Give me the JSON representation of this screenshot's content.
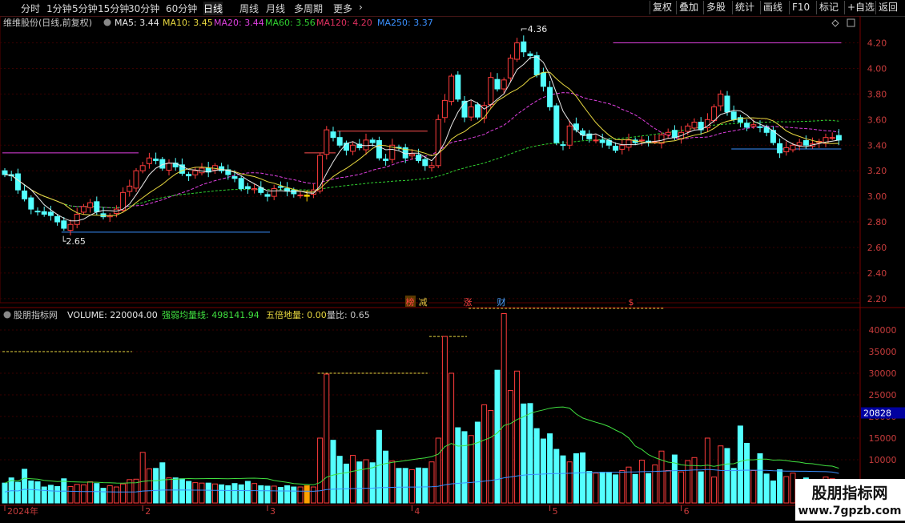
{
  "toolbar": {
    "period_tabs": [
      "分时",
      "1分钟",
      "5分钟",
      "15分钟",
      "30分钟",
      "60分钟",
      "日线",
      "周线",
      "月线",
      "多周期",
      "更多"
    ],
    "active_tab": "日线",
    "right_buttons": [
      "复权",
      "叠加",
      "多股",
      "统计",
      "画线",
      "F10",
      "标记",
      "+自选",
      "返回"
    ]
  },
  "price_panel": {
    "stock_title": "维维股份(日线,前复权)",
    "ma_legend": [
      {
        "label": "MA5: 3.44",
        "color": "#e8e8e8"
      },
      {
        "label": "MA10: 3.45",
        "color": "#e8d840"
      },
      {
        "label": "MA20: 3.44",
        "color": "#e040e0"
      },
      {
        "label": "MA60: 3.56",
        "color": "#30d030"
      },
      {
        "label": "MA120: 4.20",
        "color": "#e03060"
      },
      {
        "label": "MA250: 3.37",
        "color": "#3a90ff"
      }
    ],
    "high_label": "4.36",
    "low_label": "2.65",
    "event_markers": [
      {
        "text": "榜",
        "color": "#ff4040",
        "bg": "#5a3a00"
      },
      {
        "text": "减",
        "color": "#e8c040",
        "bg": "#000"
      },
      {
        "text": "涨",
        "color": "#ff4040",
        "bg": "#000"
      },
      {
        "text": "财",
        "color": "#50a0ff",
        "bg": "#000"
      },
      {
        "text": "$",
        "color": "#ff4040",
        "bg": "#000"
      }
    ]
  },
  "volume_panel": {
    "legend": [
      {
        "label": "股朋指标网",
        "color": "#c8c8c8"
      },
      {
        "label": "VOLUME: 220004.00",
        "color": "#e8e8e8"
      },
      {
        "label": "强弱均量线: 498141.94",
        "color": "#40e040"
      },
      {
        "label": "五倍地量: 0.00",
        "color": "#e8d840"
      },
      {
        "label": "量比: 0.65",
        "color": "#c8c8c8"
      }
    ],
    "current_value_box": "20828"
  },
  "date_axis": [
    {
      "label": "2024年",
      "day": 0
    },
    {
      "label": "2",
      "day": 21
    },
    {
      "label": "3",
      "day": 40
    },
    {
      "label": "4",
      "day": 62
    },
    {
      "label": "5",
      "day": 83
    },
    {
      "label": "6",
      "day": 103
    },
    {
      "label": "7",
      "day": 124
    }
  ],
  "colors": {
    "up": "#ff3c3c",
    "down": "#54ffff",
    "background": "#000000",
    "grid": "#3a0000",
    "axis_text": "#c83c3c"
  },
  "chart_data": {
    "type": "candlestick",
    "price_axis": {
      "ylim": [
        2.08,
        4.36
      ],
      "ticks": [
        2.2,
        2.4,
        2.6,
        2.8,
        3.0,
        3.2,
        3.4,
        3.6,
        3.8,
        4.0,
        4.2
      ]
    },
    "volume_axis": {
      "ylim": [
        0,
        45000
      ],
      "ticks": [
        10000,
        15000,
        20000,
        25000,
        30000,
        35000,
        40000
      ]
    },
    "days": 128,
    "close": [
      3.17,
      3.16,
      3.05,
      2.98,
      2.9,
      2.88,
      2.86,
      2.85,
      2.8,
      2.75,
      2.78,
      2.86,
      2.92,
      2.95,
      2.88,
      2.84,
      2.85,
      2.9,
      3.03,
      3.08,
      3.2,
      3.24,
      3.3,
      3.28,
      3.22,
      3.26,
      3.23,
      3.18,
      3.16,
      3.2,
      3.22,
      3.19,
      3.24,
      3.2,
      3.17,
      3.14,
      3.06,
      3.06,
      3.06,
      3.03,
      3.0,
      3.06,
      3.07,
      3.04,
      3.02,
      3.01,
      3.0,
      3.05,
      3.32,
      3.52,
      3.46,
      3.4,
      3.36,
      3.4,
      3.38,
      3.44,
      3.42,
      3.3,
      3.28,
      3.4,
      3.38,
      3.3,
      3.33,
      3.28,
      3.24,
      3.24,
      3.6,
      3.75,
      3.94,
      3.76,
      3.62,
      3.7,
      3.62,
      3.71,
      3.93,
      3.84,
      3.91,
      4.08,
      4.2,
      4.13,
      4.1,
      3.95,
      3.86,
      3.7,
      3.42,
      3.4,
      3.55,
      3.52,
      3.48,
      3.45,
      3.44,
      3.42,
      3.4,
      3.36,
      3.4,
      3.44,
      3.42,
      3.44,
      3.42,
      3.43,
      3.48,
      3.5,
      3.46,
      3.5,
      3.55,
      3.58,
      3.52,
      3.6,
      3.7,
      3.8,
      3.66,
      3.6,
      3.58,
      3.54,
      3.56,
      3.54,
      3.5,
      3.42,
      3.34,
      3.38,
      3.4,
      3.42,
      3.4,
      3.41,
      3.43,
      3.46,
      3.46,
      3.44
    ],
    "volume": [
      4600,
      5800,
      4800,
      7800,
      5100,
      4900,
      3700,
      4100,
      3800,
      5600,
      3800,
      4300,
      4200,
      4900,
      4500,
      3400,
      4000,
      3700,
      4400,
      5400,
      5500,
      11700,
      7900,
      8000,
      9300,
      5800,
      5800,
      5600,
      5000,
      4700,
      4600,
      4600,
      4400,
      4200,
      4000,
      4500,
      4200,
      5000,
      4500,
      4000,
      3900,
      3900,
      3600,
      4000,
      3700,
      3700,
      4000,
      3700,
      15000,
      29800,
      14500,
      10800,
      9000,
      11000,
      9500,
      10000,
      9300,
      16800,
      12000,
      9700,
      8000,
      8000,
      7700,
      8100,
      8000,
      9500,
      15000,
      38500,
      30000,
      17400,
      16500,
      15600,
      18700,
      22700,
      21400,
      30700,
      43800,
      26000,
      30500,
      22900,
      23000,
      17200,
      14800,
      16000,
      12400,
      10900,
      9500,
      11400,
      11600,
      7300,
      6900,
      7100,
      7100,
      6500,
      7500,
      8300,
      6600,
      9900,
      6800,
      8800,
      12000,
      7500,
      11100,
      7200,
      9800,
      10500,
      7200,
      15000,
      6000,
      13200,
      12600,
      8000,
      17800,
      13800,
      7500,
      11400,
      6700,
      5100,
      7700,
      6100,
      6900,
      5200,
      5800,
      5300,
      4800,
      6000,
      5600,
      5200
    ],
    "horizontal_levels": [
      {
        "kind": "price",
        "value": 4.2,
        "from": 93,
        "to": 127,
        "color": "#e040e0"
      },
      {
        "kind": "price",
        "value": 3.34,
        "from": 0,
        "to": 20,
        "color": "#e040e0"
      },
      {
        "kind": "price",
        "value": 3.34,
        "from": 46,
        "to": 50,
        "color": "#ff5050"
      },
      {
        "kind": "price",
        "value": 3.51,
        "from": 51,
        "to": 64,
        "color": "#ff5050"
      },
      {
        "kind": "price",
        "value": 2.72,
        "from": 9,
        "to": 40,
        "color": "#3a90ff"
      },
      {
        "kind": "price",
        "value": 3.37,
        "from": 111,
        "to": 127,
        "color": "#3a90ff"
      },
      {
        "kind": "volume",
        "value": 35000,
        "from": 0,
        "to": 19,
        "color": "#e8d840"
      },
      {
        "kind": "volume",
        "value": 30000,
        "from": 48,
        "to": 64,
        "color": "#e8d840"
      },
      {
        "kind": "volume",
        "value": 38500,
        "from": 65,
        "to": 70,
        "color": "#e8d840"
      },
      {
        "kind": "volume",
        "value": 45000,
        "from": 71,
        "to": 100,
        "color": "#e8d840"
      }
    ],
    "highlight_day": 46
  }
}
